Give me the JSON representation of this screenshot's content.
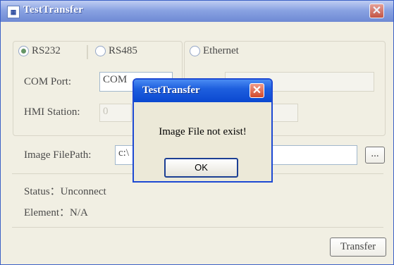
{
  "window": {
    "title": "TestTransfer",
    "icon_name": "app-icon",
    "close_glyph": "✕"
  },
  "connection": {
    "rs232_label": "RS232",
    "rs485_label": "RS485",
    "ethernet_label": "Ethernet",
    "selected": "RS232",
    "com_port_label": "COM Port:",
    "com_port_value": "COM",
    "hmi_station_label": "HMI Station:",
    "hmi_station_value": "0"
  },
  "image": {
    "filepath_label": "Image FilePath:",
    "filepath_value": "c:\\",
    "browse_label": "..."
  },
  "status": {
    "status_line": "Status：Unconnect",
    "element_line": "Element：N/A"
  },
  "actions": {
    "transfer_label": "Transfer"
  },
  "dialog": {
    "title": "TestTransfer",
    "message": "Image File not exist!",
    "ok_label": "OK",
    "close_glyph": "✕"
  },
  "colors": {
    "dialog_title_blue": "#1e5fde",
    "close_red": "#d24a2b",
    "window_bg": "#ece9d8"
  }
}
